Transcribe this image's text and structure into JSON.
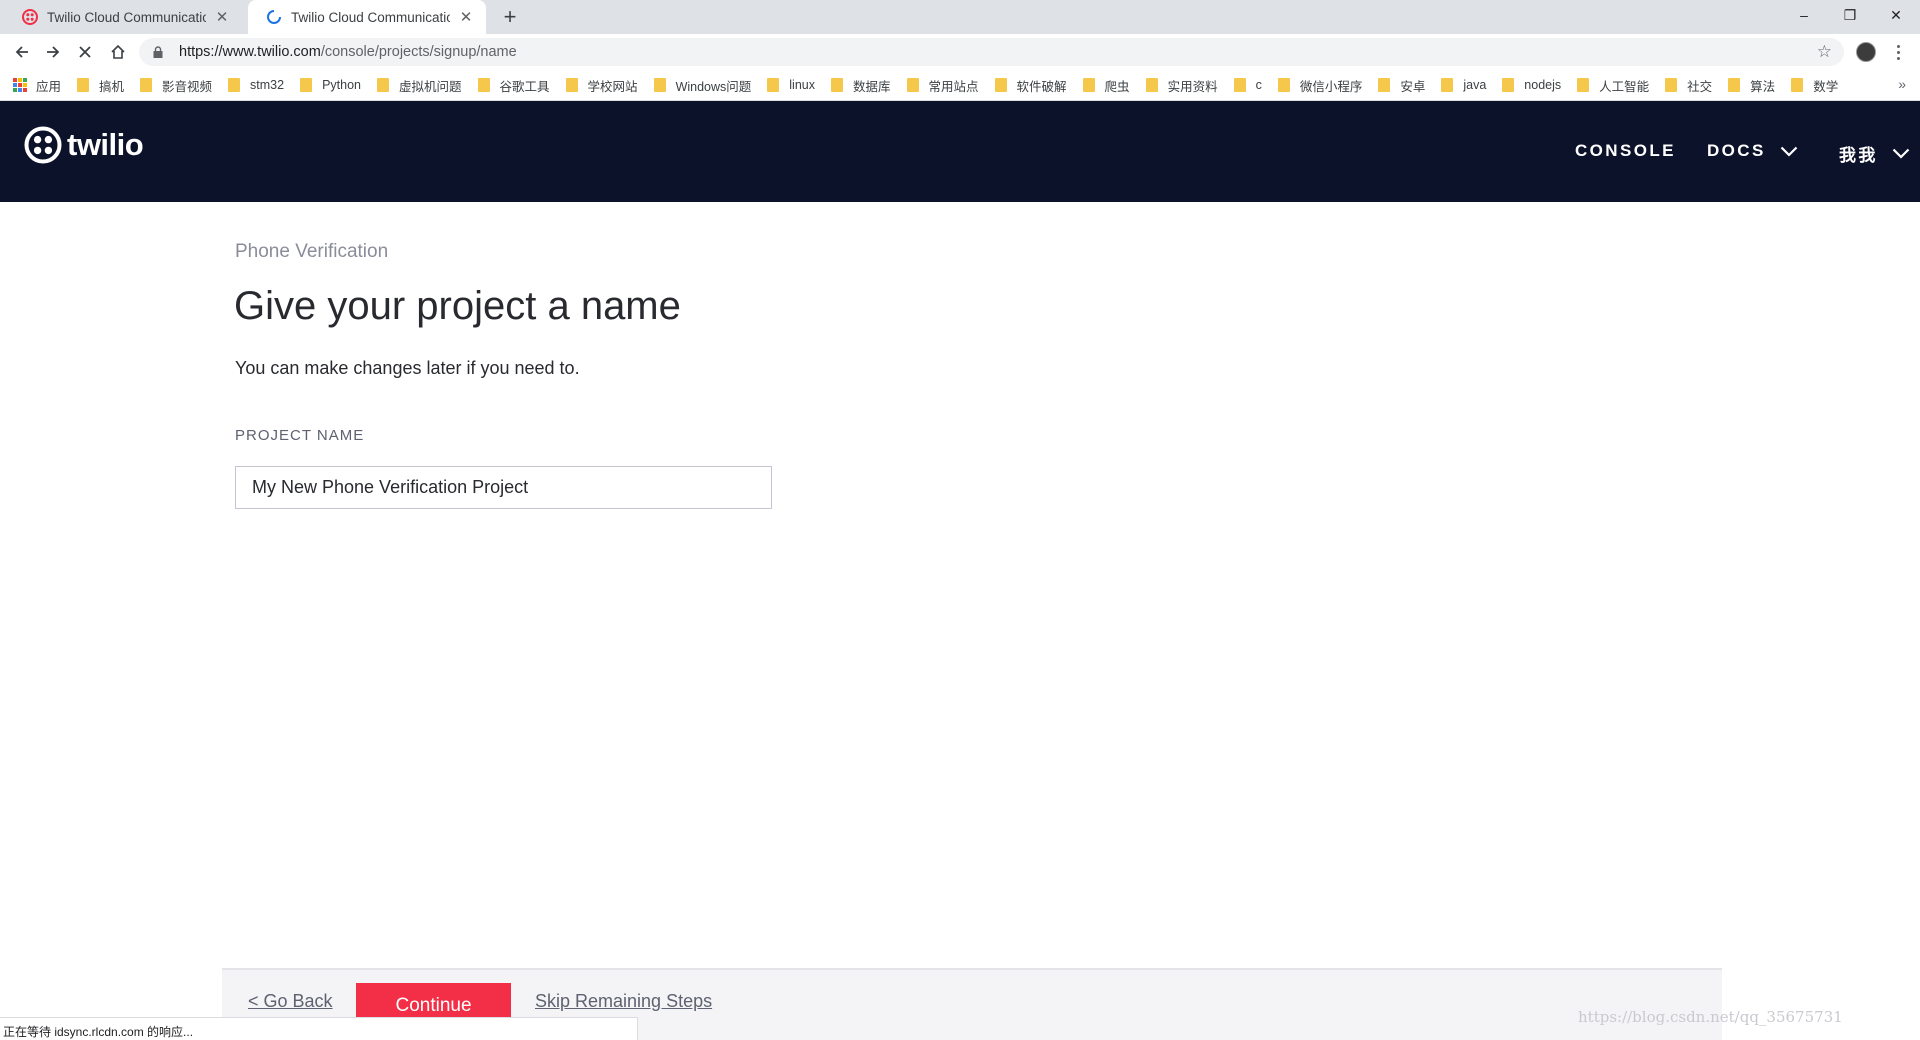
{
  "browser": {
    "tabs": [
      {
        "title": "Twilio Cloud Communications",
        "favicon": "twilio-favicon-icon",
        "state": "inactive"
      },
      {
        "title": "Twilio Cloud Communications",
        "favicon": "loading-spinner-icon",
        "state": "active"
      }
    ],
    "new_tab": "+",
    "window_controls": {
      "minimize": "–",
      "restore": "❐",
      "close": "✕"
    },
    "url_host": "https://www.twilio.com",
    "url_path": "/console/projects/signup/name",
    "bookmarks": [
      "应用",
      "搞机",
      "影音视频",
      "stm32",
      "Python",
      "虚拟机问题",
      "谷歌工具",
      "学校网站",
      "Windows问题",
      "linux",
      "数据库",
      "常用站点",
      "软件破解",
      "爬虫",
      "实用资料",
      "c",
      "微信小程序",
      "安卓",
      "java",
      "nodejs",
      "人工智能",
      "社交",
      "算法",
      "数学"
    ],
    "bookmarks_more": "»",
    "status_text": "正在等待 idsync.rlcdn.com 的响应..."
  },
  "header": {
    "logo_text": "twilio",
    "nav": {
      "console": "CONSOLE",
      "docs": "DOCS",
      "user": "我我"
    }
  },
  "main": {
    "eyebrow": "Phone Verification",
    "title": "Give your project a name",
    "subtitle": "You can make changes later if you need to.",
    "field_label": "PROJECT NAME",
    "field_value": "My New Phone Verification Project"
  },
  "footer": {
    "go_back": "< Go Back",
    "continue": "Continue",
    "skip": "Skip Remaining Steps"
  },
  "watermark": "https://blog.csdn.net/qq_35675731",
  "colors": {
    "header_bg": "#0d122b",
    "accent_red": "#f22f46",
    "bookmark_folder": "#f5c84c"
  }
}
